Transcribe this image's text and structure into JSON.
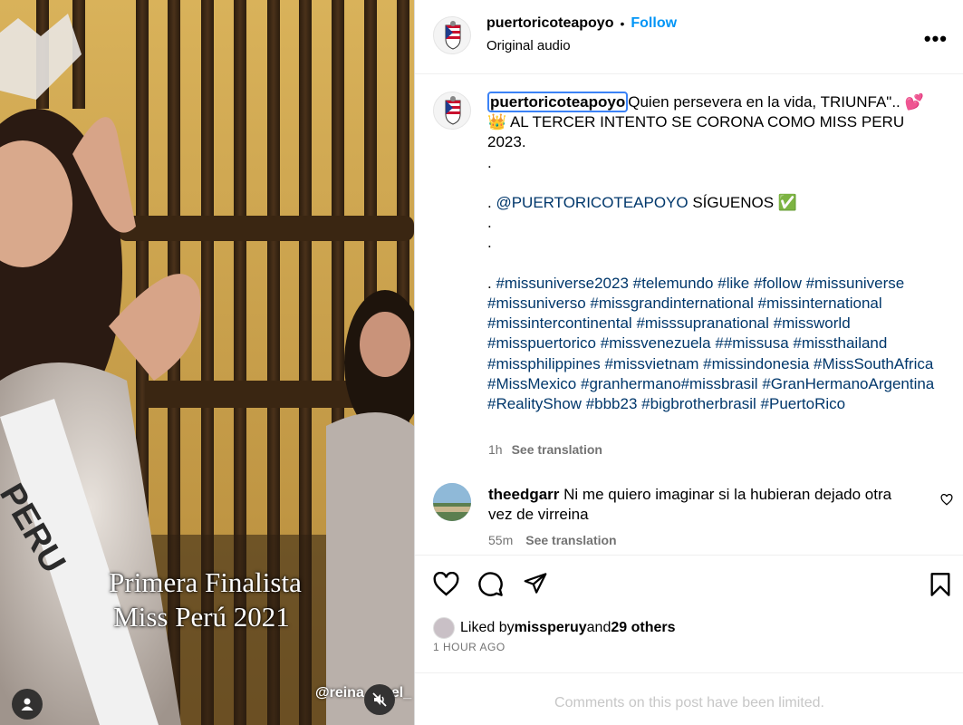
{
  "media": {
    "caption_line1": "Primera Finalista",
    "caption_line2": "Miss Perú 2021",
    "sash_text": "PERU",
    "watermark": "@reina",
    "watermark_tail": "el_"
  },
  "header": {
    "username": "puertoricoteapoyo",
    "separator": "•",
    "follow_label": "Follow",
    "audio_label": "Original audio",
    "more_label": "•••"
  },
  "caption": {
    "username": "puertoricoteapoyo",
    "line1": "Quien persevera en la vida, TRIUNFA\"..",
    "emoji1": "💕",
    "emoji2": "👑",
    "line2": " AL TERCER INTENTO SE CORONA COMO MISS PERU 2023.",
    "dot1": ".",
    "mention_prefix": ". ",
    "mention": "@PUERTORICOTEAPOYO",
    "mention_suffix": " SÍGUENOS ",
    "check_emoji": "✅",
    "dot2": ".",
    "dot3": ".",
    "hashtag_prefix": ". ",
    "hashtags": [
      "#missuniverse2023",
      "#telemundo",
      "#like",
      "#follow",
      "#missuniverse",
      "#missuniverso",
      "#missgrandinternational",
      "#missinternational",
      "#missintercontinental",
      "#misssupranational",
      "#missworld",
      "#misspuertorico",
      "#missvenezuela",
      "#",
      "#missusa",
      "#missthailand",
      "#missphilippines",
      "#missvietnam",
      "#missindonesia",
      "#MissSouthAfrica",
      "#MissMexico",
      "#granhermano",
      "#missbrasil",
      "#GranHermanoArgentina",
      "#RealityShow",
      "#bbb23",
      "#bigbrotherbrasil",
      "#PuertoRico"
    ],
    "time": "1h",
    "see_translation": "See translation"
  },
  "comment": {
    "username": "theedgarr",
    "text": "Ni me quiero imaginar si la hubieran dejado otra vez de virreina",
    "time": "55m",
    "see_translation": "See translation"
  },
  "actions": {
    "liked_by_prefix": "Liked by ",
    "liked_user": "missperuy",
    "and": " and ",
    "others": "29 others",
    "ago": "1 HOUR AGO",
    "limited": "Comments on this post have been limited."
  },
  "colors": {
    "accent": "#0095f6",
    "hashtag": "#00376b",
    "muted": "#737373",
    "focus_ring": "#3b82f6"
  }
}
